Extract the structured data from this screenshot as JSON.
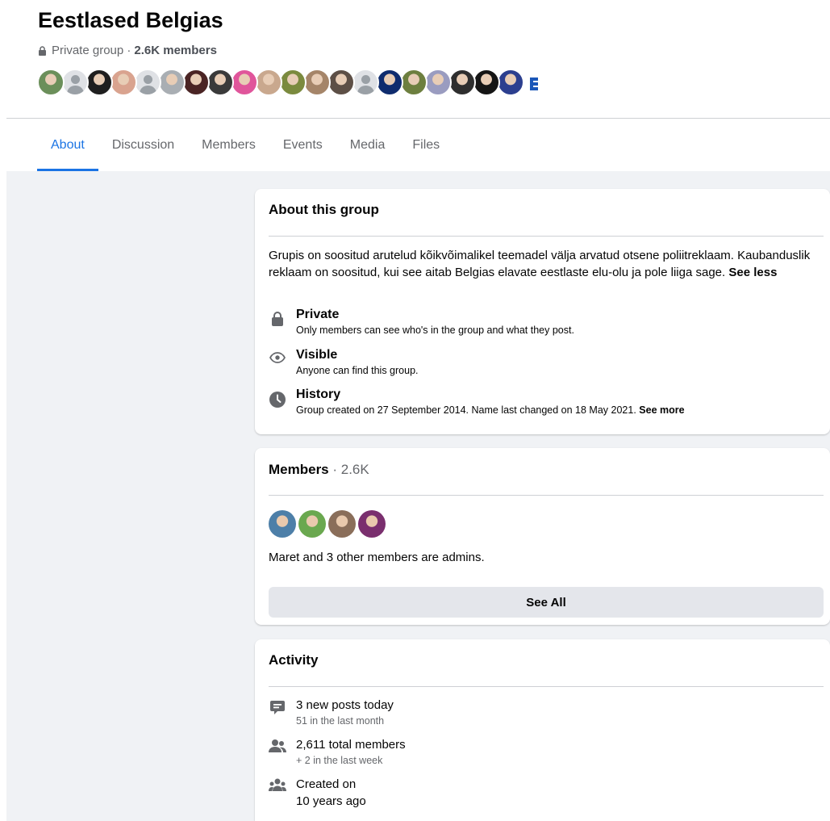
{
  "group": {
    "title": "Eestlased Belgias",
    "privacy": "Private group ·",
    "member_count": "2.6K members",
    "avatars": [
      {
        "type": "photo",
        "color": "#6b8f5a"
      },
      {
        "type": "default"
      },
      {
        "type": "photo",
        "color": "#1f1f1f"
      },
      {
        "type": "photo",
        "color": "#d9a38f"
      },
      {
        "type": "default"
      },
      {
        "type": "photo",
        "color": "#a9aeb3"
      },
      {
        "type": "photo",
        "color": "#4a2424"
      },
      {
        "type": "photo",
        "color": "#3a3a3a"
      },
      {
        "type": "photo",
        "color": "#e0559b"
      },
      {
        "type": "photo",
        "color": "#c9a88e"
      },
      {
        "type": "photo",
        "color": "#7b8a3e"
      },
      {
        "type": "photo",
        "color": "#a58569"
      },
      {
        "type": "photo",
        "color": "#5d4f46"
      },
      {
        "type": "default"
      },
      {
        "type": "photo",
        "color": "#0f2c6e"
      },
      {
        "type": "photo",
        "color": "#6d7f3f"
      },
      {
        "type": "photo",
        "color": "#9a9cc0"
      },
      {
        "type": "photo",
        "color": "#2e2e2e"
      },
      {
        "type": "photo",
        "color": "#151515"
      },
      {
        "type": "photo",
        "color": "#2c3f8f"
      },
      {
        "type": "logo"
      }
    ]
  },
  "tabs": [
    {
      "label": "About",
      "active": true
    },
    {
      "label": "Discussion",
      "active": false
    },
    {
      "label": "Members",
      "active": false
    },
    {
      "label": "Events",
      "active": false
    },
    {
      "label": "Media",
      "active": false
    },
    {
      "label": "Files",
      "active": false
    }
  ],
  "about": {
    "title": "About this group",
    "description": "Grupis on soositud arutelud kõikvõimalikel teemadel välja arvatud otsene poliitreklaam. Kaubanduslik reklaam on soositud, kui see aitab Belgias elavate eestlaste elu-olu ja pole liiga sage.",
    "see_less": "See less",
    "private": {
      "title": "Private",
      "text": "Only members can see who's in the group and what they post."
    },
    "visible": {
      "title": "Visible",
      "text": "Anyone can find this group."
    },
    "history": {
      "title": "History",
      "text": "Group created on 27 September 2014. Name last changed on 18 May 2021.",
      "see_more": "See more"
    }
  },
  "members": {
    "title": "Members",
    "count": "· 2.6K",
    "admin_colors": [
      "#4d7fa8",
      "#6aa84f",
      "#8a6e5a",
      "#7a2f6e"
    ],
    "admins_text": "Maret and 3 other members are admins.",
    "see_all": "See All"
  },
  "activity": {
    "title": "Activity",
    "posts": {
      "title": "3 new posts today",
      "sub": "51 in the last month"
    },
    "total": {
      "title": "2,611 total members",
      "sub": "+ 2 in the last week"
    },
    "created": {
      "title": "Created on",
      "sub": "10 years ago"
    }
  },
  "colors": {
    "accent": "#1b74e4",
    "page_bg": "#f0f2f5",
    "secondary_text": "#65676b"
  }
}
